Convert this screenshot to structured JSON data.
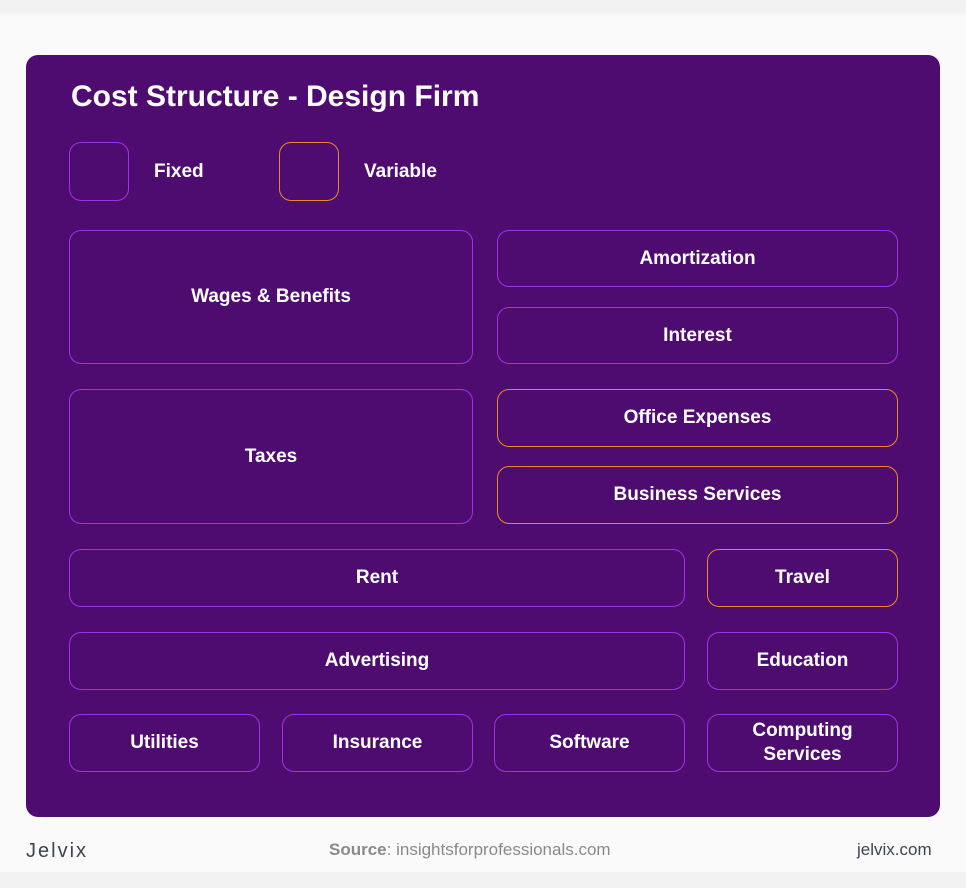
{
  "title": "Cost Structure - Design Firm",
  "legend": {
    "fixed": "Fixed",
    "variable": "Variable"
  },
  "colors": {
    "background": "#4f0c70",
    "fixed": "#a033e0",
    "variable": "#e88a26"
  },
  "boxes": {
    "wages": "Wages & Benefits",
    "amortization": "Amortization",
    "interest": "Interest",
    "taxes": "Taxes",
    "office": "Office Expenses",
    "business": "Business Services",
    "rent": "Rent",
    "travel": "Travel",
    "advertising": "Advertising",
    "education": "Education",
    "utilities": "Utilities",
    "insurance": "Insurance",
    "software": "Software",
    "computing": "Computing Services"
  },
  "footer": {
    "logo": "Jelvix",
    "source_label": "Source",
    "source_value": ": insightsforprofessionals.com",
    "site": "jelvix.com"
  }
}
